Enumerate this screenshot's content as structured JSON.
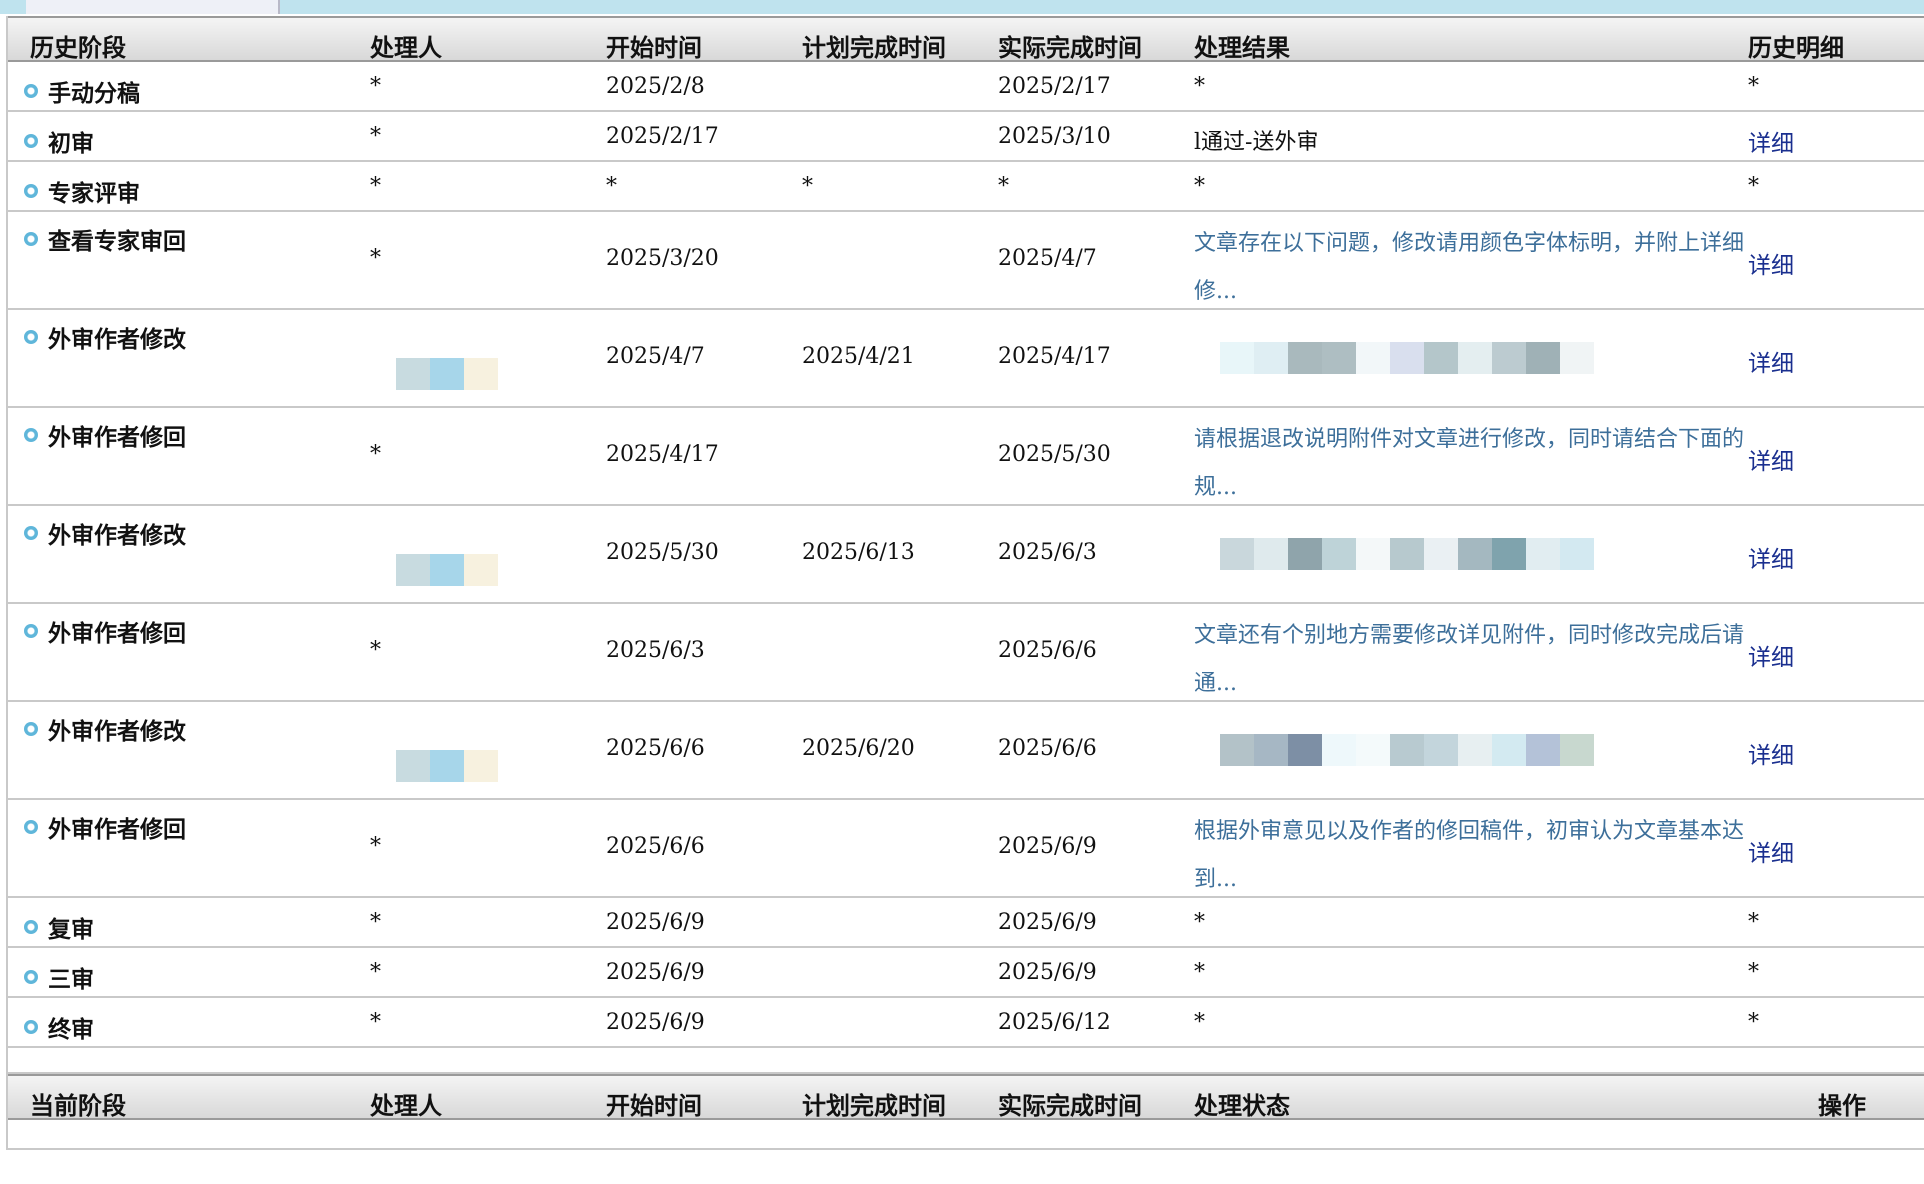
{
  "history_header": {
    "stage": "历史阶段",
    "handler": "处理人",
    "start": "开始时间",
    "plan": "计划完成时间",
    "actual": "实际完成时间",
    "result": "处理结果",
    "detail": "历史明细"
  },
  "history_rows": [
    {
      "stage": "手动分稿",
      "handler": "*",
      "start": "2025/2/8",
      "plan": "",
      "actual": "2025/2/17",
      "result": "*",
      "detail": "*"
    },
    {
      "stage": "初审",
      "handler": "*",
      "start": "2025/2/17",
      "plan": "",
      "actual": "2025/3/10",
      "result": "l通过-送外审",
      "detail": "详细"
    },
    {
      "stage": "专家评审",
      "handler": "*",
      "start": "*",
      "plan": "*",
      "actual": "*",
      "result": "*",
      "detail": "*"
    },
    {
      "stage": "查看专家审回",
      "handler": "*",
      "start": "2025/3/20",
      "plan": "",
      "actual": "2025/4/7",
      "result": "文章存在以下问题，修改请用颜色字体标明，并附上详细修...",
      "detail": "详细"
    },
    {
      "stage": "外审作者修改",
      "handler": "",
      "start": "2025/4/7",
      "plan": "2025/4/21",
      "actual": "2025/4/17",
      "result": "",
      "detail": "详细"
    },
    {
      "stage": "外审作者修回",
      "handler": "*",
      "start": "2025/4/17",
      "plan": "",
      "actual": "2025/5/30",
      "result": "请根据退改说明附件对文章进行修改，同时请结合下面的规...",
      "detail": "详细"
    },
    {
      "stage": "外审作者修改",
      "handler": "",
      "start": "2025/5/30",
      "plan": "2025/6/13",
      "actual": "2025/6/3",
      "result": "",
      "detail": "详细"
    },
    {
      "stage": "外审作者修回",
      "handler": "*",
      "start": "2025/6/3",
      "plan": "",
      "actual": "2025/6/6",
      "result": "文章还有个别地方需要修改详见附件，同时修改完成后请通...",
      "detail": "详细"
    },
    {
      "stage": "外审作者修改",
      "handler": "",
      "start": "2025/6/6",
      "plan": "2025/6/20",
      "actual": "2025/6/6",
      "result": "",
      "detail": "详细"
    },
    {
      "stage": "外审作者修回",
      "handler": "*",
      "start": "2025/6/6",
      "plan": "",
      "actual": "2025/6/9",
      "result": "根据外审意见以及作者的修回稿件，初审认为文章基本达到...",
      "detail": "详细"
    },
    {
      "stage": "复审",
      "handler": "*",
      "start": "2025/6/9",
      "plan": "",
      "actual": "2025/6/9",
      "result": "*",
      "detail": "*"
    },
    {
      "stage": "三审",
      "handler": "*",
      "start": "2025/6/9",
      "plan": "",
      "actual": "2025/6/9",
      "result": "*",
      "detail": "*"
    },
    {
      "stage": "终审",
      "handler": "*",
      "start": "2025/6/9",
      "plan": "",
      "actual": "2025/6/12",
      "result": "*",
      "detail": "*"
    }
  ],
  "current_header": {
    "stage": "当前阶段",
    "handler": "处理人",
    "start": "开始时间",
    "plan": "计划完成时间",
    "actual": "实际完成时间",
    "status": "处理状态",
    "action": "操作"
  },
  "colors": {
    "link": "#1a2f8f",
    "result_text": "#3d6f9a",
    "bullet": "#5fb6da",
    "top_strip": "#bfe3ee"
  }
}
